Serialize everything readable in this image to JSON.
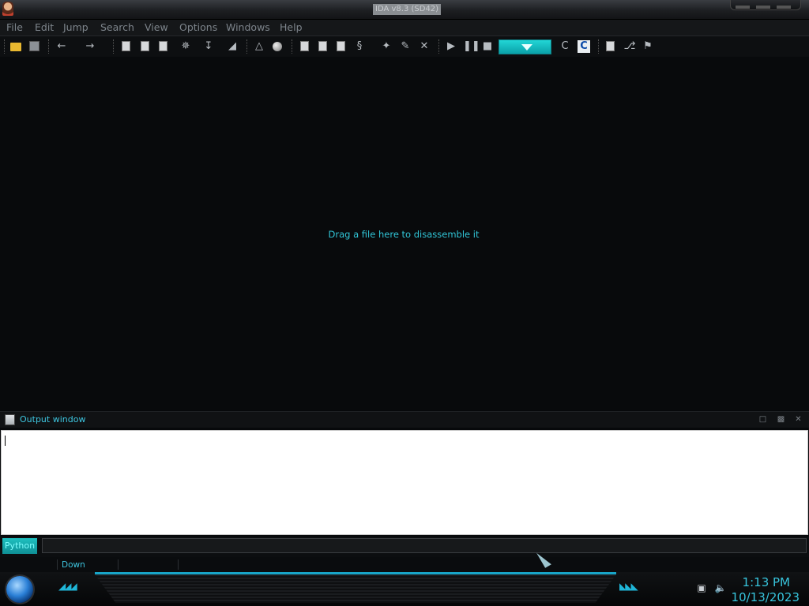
{
  "window": {
    "title": "IDA v8.3 (SD42)"
  },
  "menu": [
    "File",
    "Edit",
    "Jump",
    "Search",
    "View",
    "Options",
    "Windows",
    "Help"
  ],
  "toolbar": {
    "icons": [
      "open-icon",
      "save-icon",
      "back-icon",
      "forward-icon",
      "search-binary-icon",
      "search-text-icon",
      "search-immediate-icon",
      "next-search-icon",
      "jump-down-icon",
      "search-sequence-icon",
      "warning-icon",
      "circle-icon",
      "code-icon",
      "data-icon",
      "string-icon",
      "struct-icon",
      "plugin-icon",
      "edit-icon",
      "close-x-icon",
      "play-icon",
      "pause-icon",
      "stop-icon",
      "c-icon",
      "decompile-icon",
      "window-icon",
      "graph-icon",
      "flag-icon"
    ],
    "debugger_dropdown_color": "#1ec9cc"
  },
  "main": {
    "hint": "Drag a file here to disassemble it"
  },
  "output": {
    "title": "Output window",
    "text": ""
  },
  "cmd": {
    "button": "Python",
    "value": ""
  },
  "status": {
    "text": "Down"
  },
  "clock": {
    "time": "1:13 PM",
    "date": "10/13/2023"
  },
  "colors": {
    "accent": "#31c6d8",
    "background": "#080a0c"
  }
}
